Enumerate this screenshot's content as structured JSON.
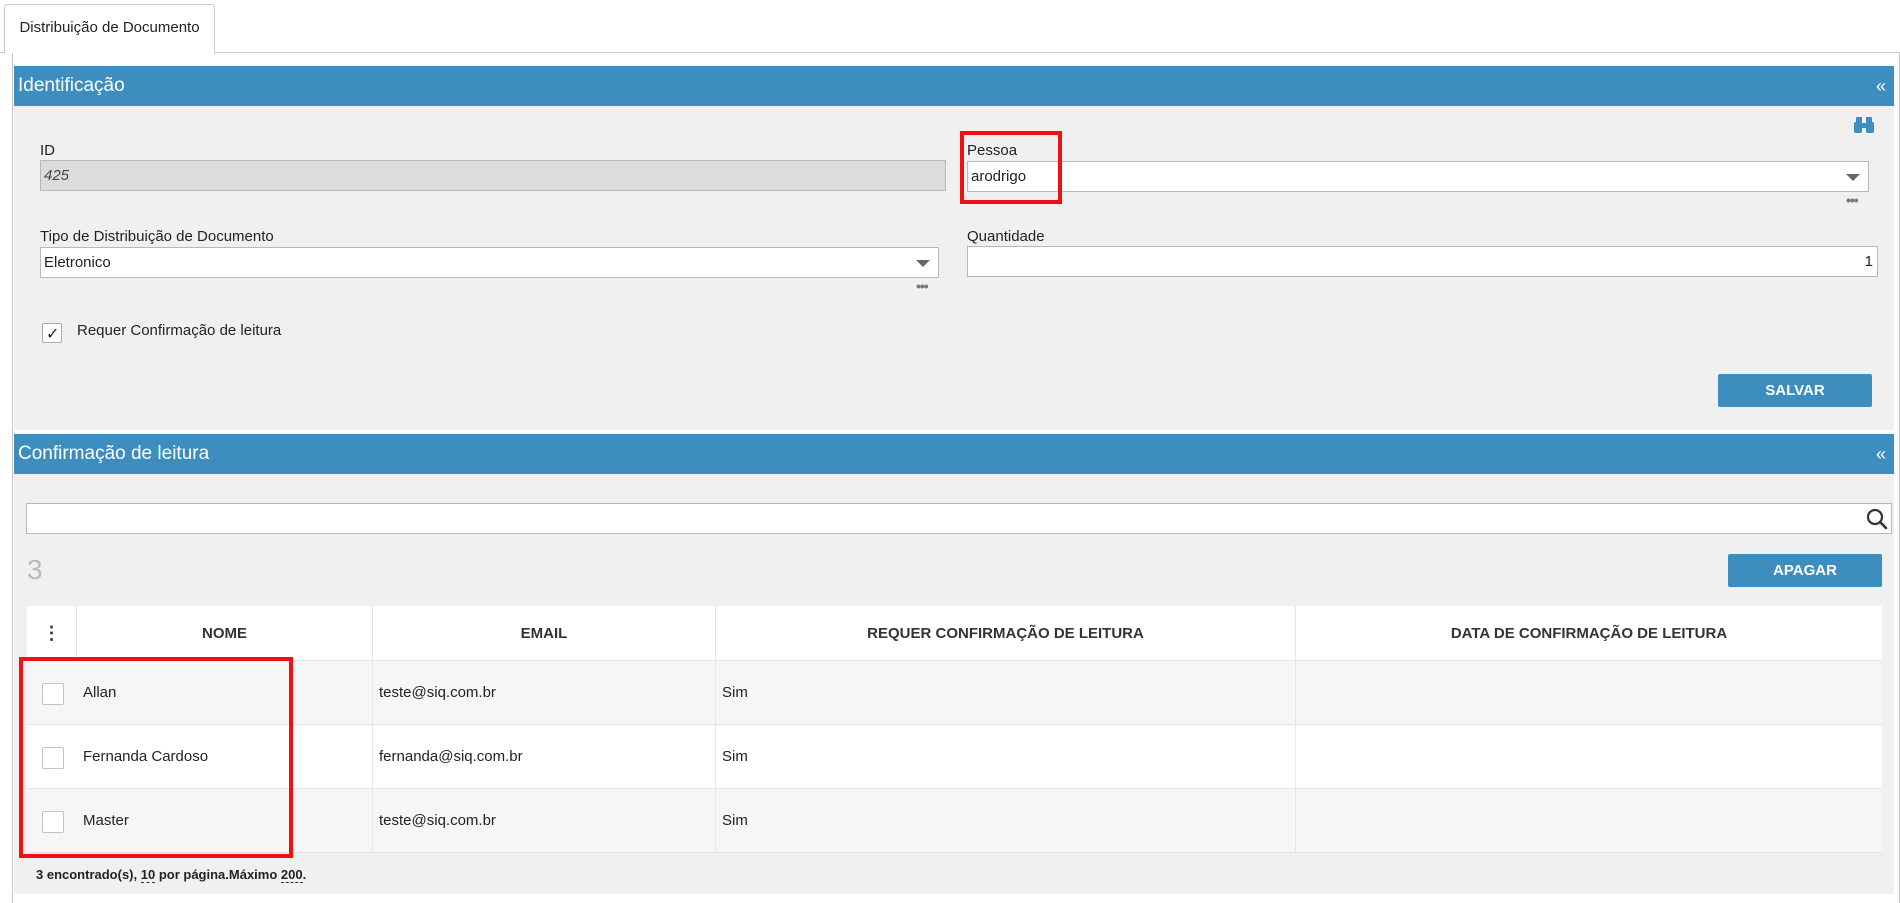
{
  "tab": {
    "label": "Distribuição de Documento"
  },
  "identificacao": {
    "title": "Identificação",
    "collapse": "«",
    "id_label": "ID",
    "id_value": "425",
    "pessoa_label": "Pessoa",
    "pessoa_value": "arodrigo",
    "tipo_label": "Tipo de Distribuição de Documento",
    "tipo_value": "Eletronico",
    "quantidade_label": "Quantidade",
    "quantidade_value": "1",
    "requer_label": "Requer Confirmação de leitura",
    "requer_checked": true,
    "dots": "•••",
    "save_label": "SALVAR"
  },
  "confirmacao": {
    "title": "Confirmação de leitura",
    "collapse": "«",
    "search_value": "",
    "count": "3",
    "delete_label": "APAGAR",
    "menu_glyph": "⋮",
    "columns": [
      "NOME",
      "EMAIL",
      "REQUER CONFIRMAÇÃO DE LEITURA",
      "DATA DE CONFIRMAÇÃO DE LEITURA"
    ],
    "rows": [
      {
        "nome": "Allan",
        "email": "teste@siq.com.br",
        "requer": "Sim",
        "data": ""
      },
      {
        "nome": "Fernanda Cardoso",
        "email": "fernanda@siq.com.br",
        "requer": "Sim",
        "data": ""
      },
      {
        "nome": "Master",
        "email": "teste@siq.com.br",
        "requer": "Sim",
        "data": ""
      }
    ],
    "footer": {
      "found": "3 encontrado(s), ",
      "per_page": "10",
      "per_page_suffix": " por página.Máximo ",
      "max": "200",
      "end": "."
    }
  },
  "colors": {
    "header": "#3e8dbf",
    "panel_bg": "#f0f0f0",
    "highlight": "#ee1111"
  }
}
